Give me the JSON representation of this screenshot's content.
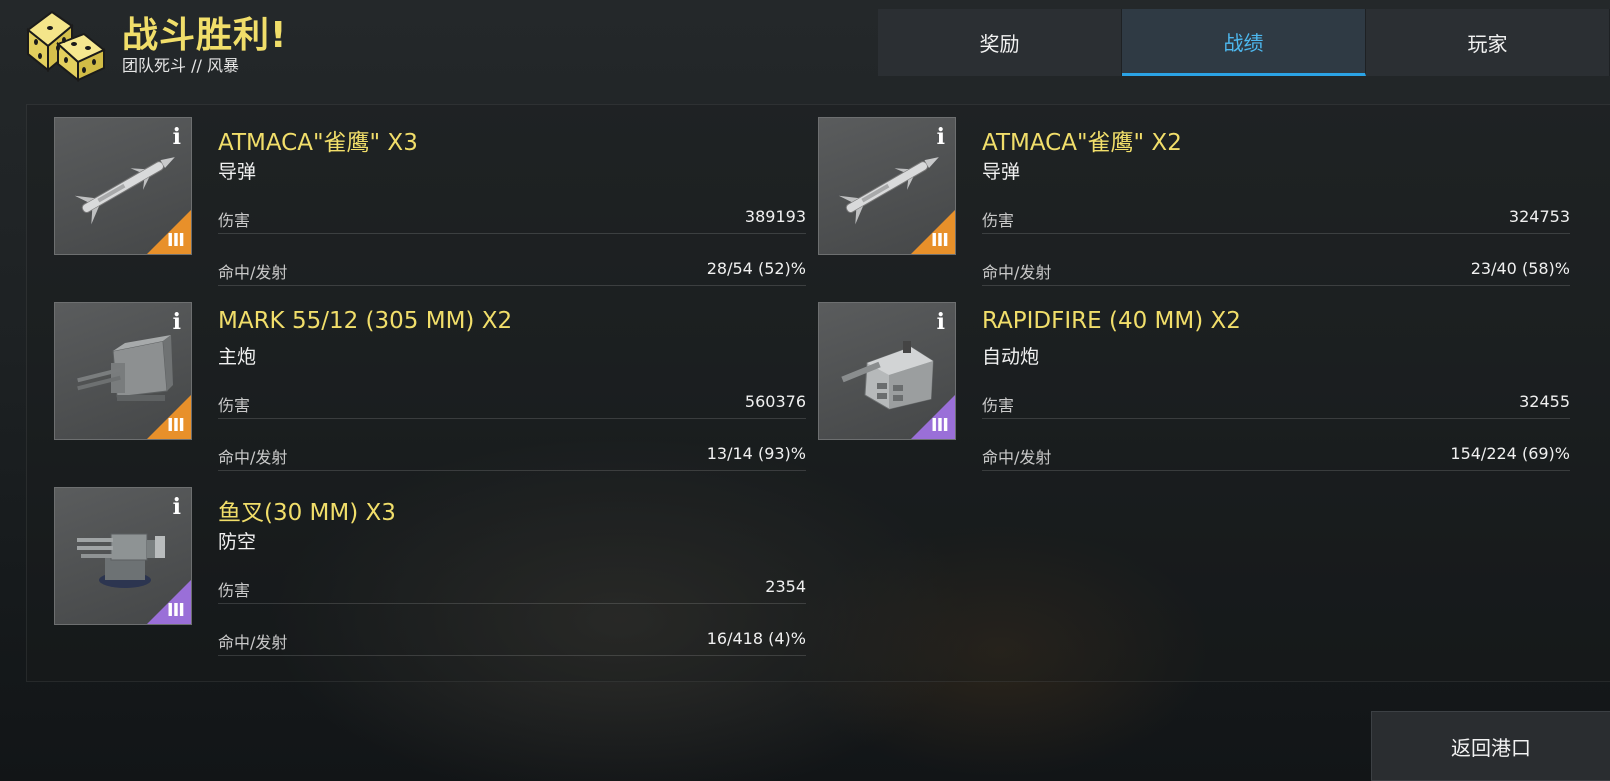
{
  "header": {
    "title": "战斗胜利!",
    "subtitle": "团队死斗 // 风暴"
  },
  "tabs": [
    {
      "label": "奖励",
      "active": false
    },
    {
      "label": "战绩",
      "active": true
    },
    {
      "label": "玩家",
      "active": false
    }
  ],
  "weapons": [
    {
      "name": "ATMACA\"雀鹰\" X3",
      "type": "导弹",
      "damage_label": "伤害",
      "damage": "389193",
      "hit_label": "命中/发射",
      "hits": "28/54 (52)%",
      "tier": "III",
      "tier_color": "#e8902a",
      "icon": "missile-icon"
    },
    {
      "name": "ATMACA\"雀鹰\" X2",
      "type": "导弹",
      "damage_label": "伤害",
      "damage": "324753",
      "hit_label": "命中/发射",
      "hits": "23/40 (58)%",
      "tier": "III",
      "tier_color": "#e8902a",
      "icon": "missile-icon"
    },
    {
      "name": "MARK 55/12 (305 MM) X2",
      "type": "主炮",
      "damage_label": "伤害",
      "damage": "560376",
      "hit_label": "命中/发射",
      "hits": "13/14 (93)%",
      "tier": "III",
      "tier_color": "#e8902a",
      "icon": "main-gun-turret-icon"
    },
    {
      "name": "RAPIDFIRE (40 MM) X2",
      "type": "自动炮",
      "damage_label": "伤害",
      "damage": "32455",
      "hit_label": "命中/发射",
      "hits": "154/224 (69)%",
      "tier": "III",
      "tier_color": "#9a6fd8",
      "icon": "autocannon-turret-icon"
    },
    {
      "name": "鱼叉(30 MM) X3",
      "type": "防空",
      "damage_label": "伤害",
      "damage": "2354",
      "hit_label": "命中/发射",
      "hits": "16/418 (4)%",
      "tier": "III",
      "tier_color": "#9a6fd8",
      "icon": "aa-gun-icon"
    }
  ],
  "back_button": {
    "label": "返回港口"
  },
  "colors": {
    "title": "#f1de6a",
    "active_tab": "#4db8ef",
    "orange_tier": "#e8902a",
    "purple_tier": "#9a6fd8"
  }
}
